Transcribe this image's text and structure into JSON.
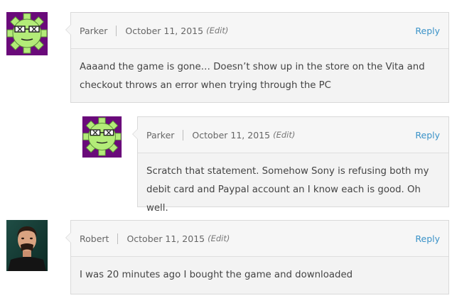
{
  "comments": [
    {
      "author": "Parker",
      "date": "October 11, 2015",
      "edit_label": "(Edit)",
      "reply_label": "Reply",
      "text": "Aaaand the game is gone… Doesn’t show up in the store on the Vita and checkout throws an error when trying through the PC",
      "avatar_icon": "green-gear-glasses-avatar"
    },
    {
      "author": "Parker",
      "date": "October 11, 2015",
      "edit_label": "(Edit)",
      "reply_label": "Reply",
      "text": "Scratch that statement. Somehow Sony is refusing both my debit card and Paypal account an I know each is good. Oh well.",
      "avatar_icon": "green-gear-glasses-avatar"
    },
    {
      "author": "Robert",
      "date": "October 11, 2015",
      "edit_label": "(Edit)",
      "reply_label": "Reply",
      "text": "I was 20 minutes ago I bought the game and downloaded",
      "avatar_icon": "user-photo-avatar"
    }
  ],
  "colors": {
    "link": "#3a92c8",
    "avatar_bg": "#6a0a7a",
    "gear": "#b3ec78"
  }
}
